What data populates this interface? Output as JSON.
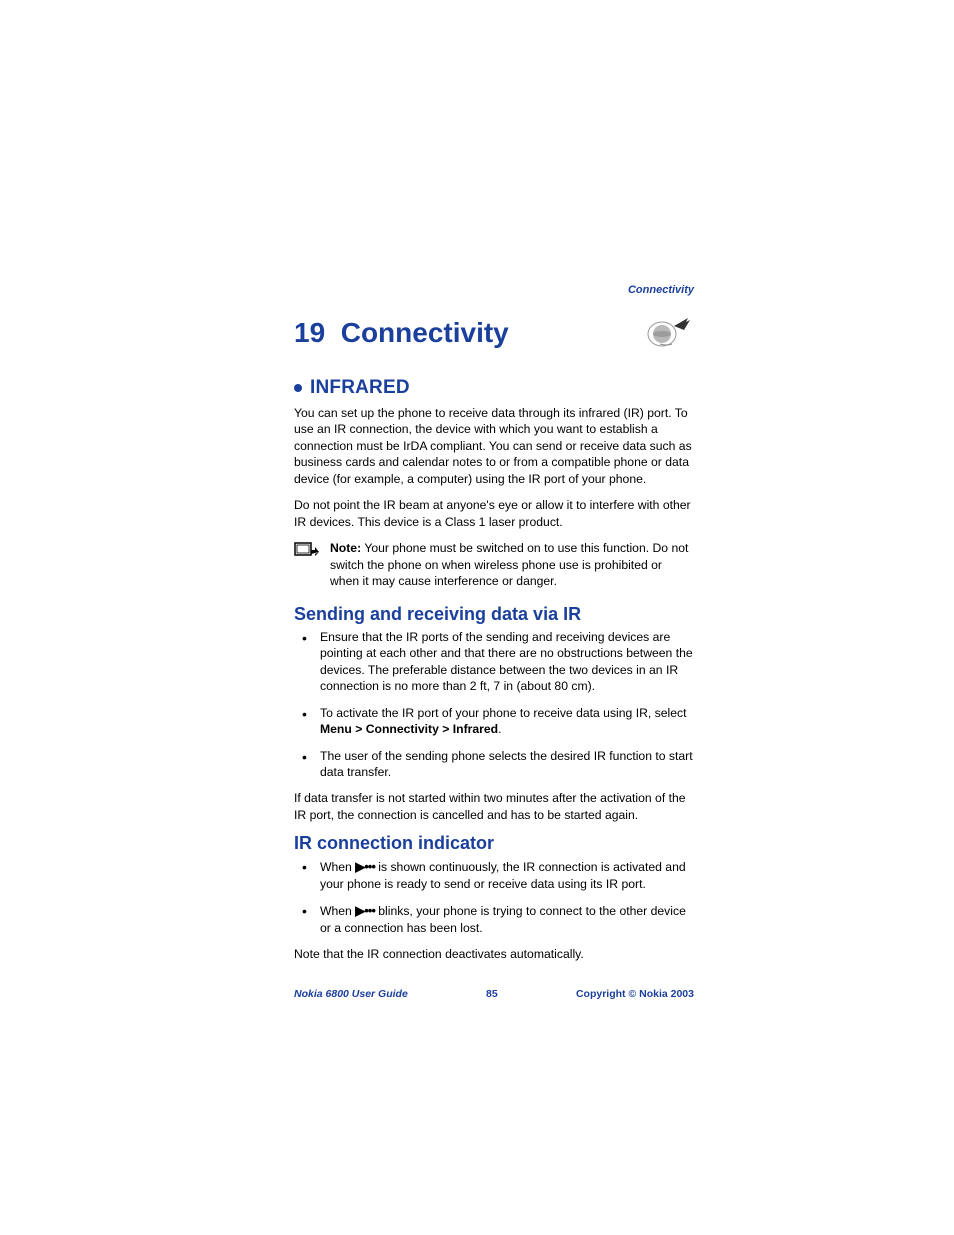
{
  "header": {
    "label": "Connectivity"
  },
  "chapter": {
    "number": "19",
    "title": "Connectivity"
  },
  "sections": {
    "infrared": {
      "title": "INFRARED",
      "p1": "You can set up the phone to receive data through its infrared (IR) port. To use an IR connection, the device with which you want to establish a connection must be IrDA compliant. You can send or receive data such as business cards and calendar notes to or from a compatible phone or data device (for example, a computer) using the IR port of your phone.",
      "p2": "Do not point the IR beam at anyone's eye or allow it to interfere with other IR devices. This device is a Class 1 laser product.",
      "note_label": "Note:",
      "note_text": " Your phone must be switched on to use this function. Do not switch the phone on when wireless phone use is prohibited or when it may cause interference or danger."
    },
    "sending": {
      "title": "Sending and receiving data via IR",
      "b1": "Ensure that the IR ports of the sending and receiving devices are pointing at each other and that there are no obstructions between the devices. The preferable distance between the two devices in an IR connection is no more than 2 ft, 7 in (about 80 cm).",
      "b2_pre": "To activate the IR port of your phone to receive data using IR, select ",
      "b2_menu": "Menu > Connectivity > Infrared",
      "b2_post": ".",
      "b3": "The user of the sending phone selects the desired IR function to start data transfer.",
      "p_after": "If data transfer is not started within two minutes after the activation of the IR port, the connection is cancelled and has to be started again."
    },
    "indicator": {
      "title": "IR connection indicator",
      "b1_pre": "When ",
      "b1_glyph": "▶•••",
      "b1_post": " is shown continuously, the IR connection is activated and your phone is ready to send or receive data using its IR port.",
      "b2_pre": "When ",
      "b2_glyph": "▶•••",
      "b2_post": " blinks, your phone is trying to connect to the other device or a connection has been lost.",
      "p_after": "Note that the IR connection deactivates automatically."
    }
  },
  "footer": {
    "left": "Nokia 6800 User Guide",
    "center": "85",
    "right": "Copyright © Nokia 2003"
  }
}
